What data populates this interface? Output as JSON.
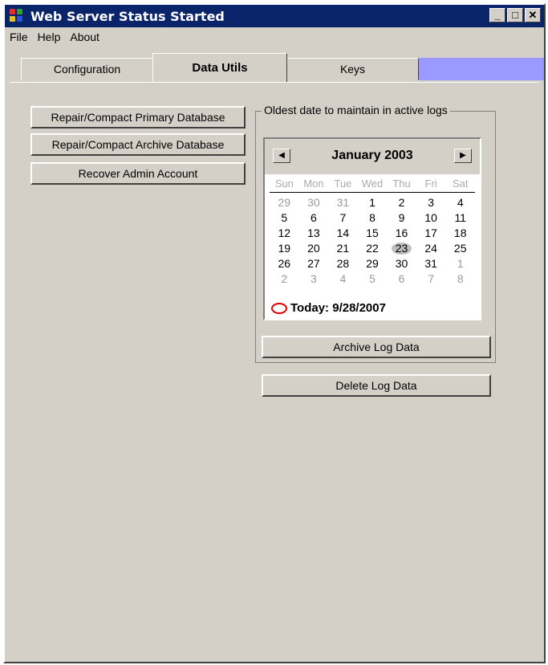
{
  "window": {
    "title": "Web Server Status Started"
  },
  "title_controls": {
    "minimize": "_",
    "maximize": "□",
    "close": "✕"
  },
  "menu": [
    "File",
    "Help",
    "About"
  ],
  "tabs": [
    {
      "label": "Configuration",
      "active": false
    },
    {
      "label": "Data Utils",
      "active": true
    },
    {
      "label": "Keys",
      "active": false
    }
  ],
  "buttons": {
    "repair_primary": "Repair/Compact Primary Database",
    "repair_archive": "Repair/Compact Archive Database",
    "recover_admin": "Recover Admin Account",
    "archive_log": "Archive Log Data",
    "delete_log": "Delete Log Data"
  },
  "group": {
    "label": "Oldest date to maintain in active logs"
  },
  "calendar": {
    "title": "January 2003",
    "prev": "◀",
    "next": "▶",
    "weekdays": [
      "Sun",
      "Mon",
      "Tue",
      "Wed",
      "Thu",
      "Fri",
      "Sat"
    ],
    "days": [
      {
        "d": "29",
        "o": true
      },
      {
        "d": "30",
        "o": true
      },
      {
        "d": "31",
        "o": true
      },
      {
        "d": "1"
      },
      {
        "d": "2"
      },
      {
        "d": "3"
      },
      {
        "d": "4"
      },
      {
        "d": "5"
      },
      {
        "d": "6"
      },
      {
        "d": "7"
      },
      {
        "d": "8"
      },
      {
        "d": "9"
      },
      {
        "d": "10"
      },
      {
        "d": "11"
      },
      {
        "d": "12"
      },
      {
        "d": "13"
      },
      {
        "d": "14"
      },
      {
        "d": "15"
      },
      {
        "d": "16"
      },
      {
        "d": "17"
      },
      {
        "d": "18"
      },
      {
        "d": "19"
      },
      {
        "d": "20"
      },
      {
        "d": "21"
      },
      {
        "d": "22"
      },
      {
        "d": "23",
        "sel": true
      },
      {
        "d": "24"
      },
      {
        "d": "25"
      },
      {
        "d": "26"
      },
      {
        "d": "27"
      },
      {
        "d": "28"
      },
      {
        "d": "29"
      },
      {
        "d": "30"
      },
      {
        "d": "31"
      },
      {
        "d": "1",
        "o": true
      },
      {
        "d": "2",
        "o": true
      },
      {
        "d": "3",
        "o": true
      },
      {
        "d": "4",
        "o": true
      },
      {
        "d": "5",
        "o": true
      },
      {
        "d": "6",
        "o": true
      },
      {
        "d": "7",
        "o": true
      },
      {
        "d": "8",
        "o": true
      }
    ],
    "today_label": "Today: 9/28/2007"
  },
  "colors": {
    "titlebar": "#0a246a",
    "face": "#d4d0c8",
    "tab_blank": "#9999ff",
    "today_mark": "#e00000"
  }
}
